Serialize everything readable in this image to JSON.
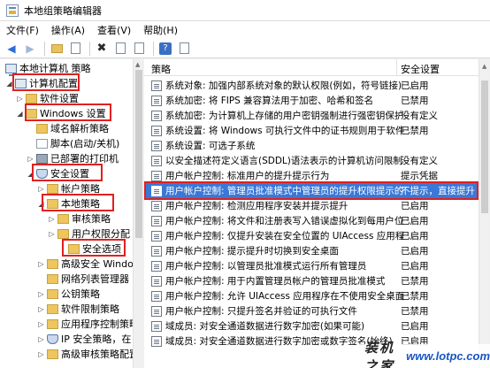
{
  "window": {
    "title": "本地组策略编辑器"
  },
  "menubar": {
    "items": [
      {
        "label": "文件(F)"
      },
      {
        "label": "操作(A)"
      },
      {
        "label": "查看(V)"
      },
      {
        "label": "帮助(H)"
      }
    ]
  },
  "toolbar": {
    "back_icon": "arrow-left-icon",
    "forward_icon": "arrow-right-icon"
  },
  "tree": {
    "items": [
      {
        "label": "本地计算机 策略",
        "icon": "computer-policy-icon"
      },
      {
        "label": "计算机配置",
        "icon": "computer-icon"
      },
      {
        "label": "软件设置",
        "icon": "folder-icon"
      },
      {
        "label": "Windows 设置",
        "icon": "folder-icon"
      },
      {
        "label": "域名解析策略",
        "icon": "folder-icon"
      },
      {
        "label": "脚本(启动/关机)",
        "icon": "script-icon"
      },
      {
        "label": "已部署的打印机",
        "icon": "printer-icon"
      },
      {
        "label": "安全设置",
        "icon": "shield-icon"
      },
      {
        "label": "帐户策略",
        "icon": "folder-icon"
      },
      {
        "label": "本地策略",
        "icon": "folder-icon"
      },
      {
        "label": "审核策略",
        "icon": "folder-icon"
      },
      {
        "label": "用户权限分配",
        "icon": "folder-icon"
      },
      {
        "label": "安全选项",
        "icon": "folder-icon"
      },
      {
        "label": "高级安全 Windows",
        "icon": "folder-icon"
      },
      {
        "label": "网络列表管理器",
        "icon": "folder-icon"
      },
      {
        "label": "公钥策略",
        "icon": "folder-icon"
      },
      {
        "label": "软件限制策略",
        "icon": "folder-icon"
      },
      {
        "label": "应用程序控制策略",
        "icon": "folder-icon"
      },
      {
        "label": "IP 安全策略，在",
        "icon": "shield-icon"
      },
      {
        "label": "高级审核策略配置",
        "icon": "folder-icon"
      }
    ]
  },
  "policy_list": {
    "col_policy": "策略",
    "col_setting": "安全设置",
    "rows": [
      {
        "name": "系统对象: 加强内部系统对象的默认权限(例如，符号链接)",
        "value": "已启用"
      },
      {
        "name": "系统加密: 将 FIPS 兼容算法用于加密、哈希和签名",
        "value": "已禁用"
      },
      {
        "name": "系统加密: 为计算机上存储的用户密钥强制进行强密钥保护",
        "value": "没有定义"
      },
      {
        "name": "系统设置: 将 Windows 可执行文件中的证书规则用于软件...",
        "value": "已禁用"
      },
      {
        "name": "系统设置: 可选子系统",
        "value": ""
      },
      {
        "name": "以安全描述符定义语言(SDDL)语法表示的计算机访问限制",
        "value": "没有定义"
      },
      {
        "name": "用户帐户控制: 标准用户的提升提示行为",
        "value": "提示凭据"
      },
      {
        "name": "用户帐户控制: 管理员批准模式中管理员的提升权限提示的...",
        "value": "不提示，直接提升"
      },
      {
        "name": "用户帐户控制: 检测应用程序安装并提示提升",
        "value": "已启用"
      },
      {
        "name": "用户帐户控制: 将文件和注册表写入错误虚拟化到每用户位置",
        "value": "已启用"
      },
      {
        "name": "用户帐户控制: 仅提升安装在安全位置的 UIAccess 应用程序",
        "value": "已启用"
      },
      {
        "name": "用户帐户控制: 提示提升时切换到安全桌面",
        "value": "已启用"
      },
      {
        "name": "用户帐户控制: 以管理员批准模式运行所有管理员",
        "value": "已启用"
      },
      {
        "name": "用户帐户控制: 用于内置管理员帐户的管理员批准模式",
        "value": "已禁用"
      },
      {
        "name": "用户帐户控制: 允许 UIAccess 应用程序在不使用安全桌面...",
        "value": "已禁用"
      },
      {
        "name": "用户帐户控制: 只提升签名并验证的可执行文件",
        "value": "已禁用"
      },
      {
        "name": "域成员: 对安全通道数据进行数字加密(如果可能)",
        "value": "已启用"
      },
      {
        "name": "域成员: 对安全通道数据进行数字加密或数字签名(始终)",
        "value": "已启用"
      }
    ],
    "selected_index": 7
  },
  "watermark": {
    "cn_text": "装机之家",
    "url": "www.lotpc.com"
  },
  "colors": {
    "selection": "#3a78d6",
    "highlight_box": "#e02020"
  }
}
